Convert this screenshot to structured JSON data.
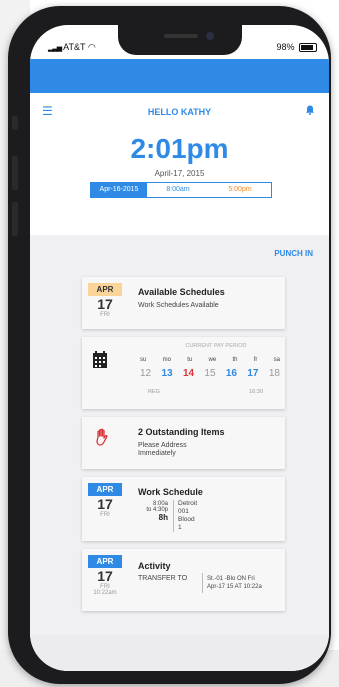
{
  "status": {
    "carrier": "AT&T",
    "battery": "98%"
  },
  "header": {
    "greeting": "HELLO KATHY"
  },
  "clock": {
    "time": "2:01pm",
    "date": "April-17, 2015"
  },
  "shift": {
    "date": "Apr-16-2015",
    "start": "8:00am",
    "end": "5:00pm"
  },
  "actions": {
    "punch_in": "PUNCH IN"
  },
  "cards": {
    "available": {
      "month": "APR",
      "day": "17",
      "weekday": "FRI",
      "title": "Available Schedules",
      "subtitle": "Work Schedules Available"
    },
    "pay_period": {
      "label": "CURRENT PAY PERIOD",
      "weekdays": [
        "su",
        "mo",
        "tu",
        "we",
        "th",
        "fr",
        "sa"
      ],
      "dates": [
        "12",
        "13",
        "14",
        "15",
        "16",
        "17",
        "18"
      ],
      "footer_left": "REG",
      "footer_right": "16:30"
    },
    "outstanding": {
      "title": "2 Outstanding Items",
      "subtitle_1": "Please Address",
      "subtitle_2": "Immediately"
    },
    "work_schedule": {
      "month": "APR",
      "day": "17",
      "weekday": "FRI",
      "title": "Work Schedule",
      "from": "8:00a",
      "to": "to 4:30p",
      "hours": "8h",
      "details": [
        "Detroit",
        "001",
        "Blood",
        "1"
      ]
    },
    "activity": {
      "month": "APR",
      "day": "17",
      "weekday": "FRI",
      "time": "10:22am",
      "title": "Activity",
      "action": "TRANSFER TO",
      "detail_1": "St.-01 -Blo ON Fri",
      "detail_2": "Apr-17 15 AT 10:22a"
    }
  },
  "colors": {
    "accent": "#2f8ae6",
    "warning": "#f08a24",
    "alert": "#d9343a",
    "month_badge": "#fbd49a"
  }
}
